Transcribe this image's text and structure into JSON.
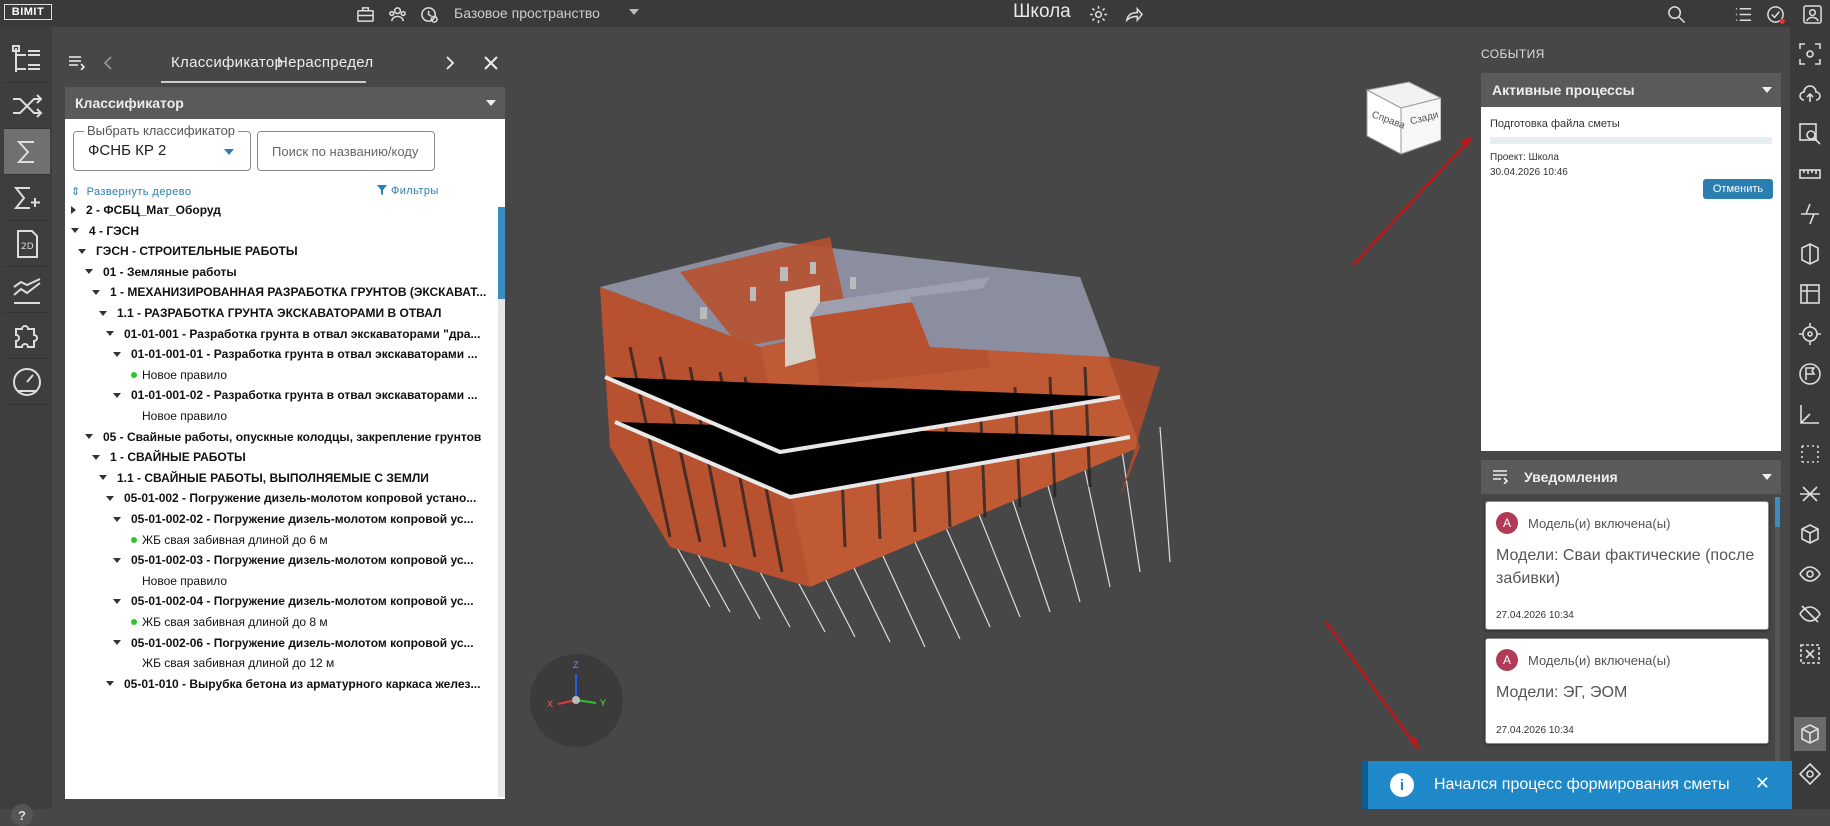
{
  "app": {
    "logo": "BIMIT",
    "space": "Базовое пространство",
    "project_title": "Школа"
  },
  "panel": {
    "tabs": [
      "Классификатор",
      "Нераспредел"
    ],
    "section_title": "Классификатор",
    "classifier_label": "Выбрать классификатор",
    "classifier_value": "ФСНБ КР 2",
    "search_placeholder": "Поиск по названию/коду",
    "expand_label": "Развернуть дерево",
    "filters_label": "Фильтры"
  },
  "tree": [
    {
      "label": "2 - ФСБЦ_Мат_Оборуд",
      "level": 0,
      "state": "collapsed"
    },
    {
      "label": "4 - ГЭСН",
      "level": 0,
      "state": "expanded"
    },
    {
      "label": "ГЭСН - СТРОИТЕЛЬНЫЕ РАБОТЫ",
      "level": 1,
      "state": "expanded"
    },
    {
      "label": "01 - Земляные работы",
      "level": 2,
      "state": "expanded"
    },
    {
      "label": "1 - МЕХАНИЗИРОВАННАЯ РАЗРАБОТКА ГРУНТОВ (ЭКСКАВАТ...",
      "level": 3,
      "state": "expanded"
    },
    {
      "label": "1.1 - РАЗРАБОТКА ГРУНТА ЭКСКАВАТОРАМИ В ОТВАЛ",
      "level": 4,
      "state": "expanded"
    },
    {
      "label": "01-01-001 - Разработка грунта в отвал экскаваторами \"дра...",
      "level": 5,
      "state": "expanded"
    },
    {
      "label": "01-01-001-01 - Разработка грунта в отвал экскаваторами ...",
      "level": 6,
      "state": "expanded"
    },
    {
      "label": "Новое правило",
      "level": 7,
      "state": "leaf",
      "dot": true
    },
    {
      "label": "01-01-001-02 - Разработка грунта в отвал экскаваторами ...",
      "level": 6,
      "state": "expanded"
    },
    {
      "label": "Новое правило",
      "level": 7,
      "state": "leaf",
      "dot": false
    },
    {
      "label": "05 - Свайные работы, опускные колодцы, закрепление грунтов",
      "level": 2,
      "state": "expanded"
    },
    {
      "label": "1 - СВАЙНЫЕ РАБОТЫ",
      "level": 3,
      "state": "expanded"
    },
    {
      "label": "1.1 - СВАЙНЫЕ РАБОТЫ, ВЫПОЛНЯЕМЫЕ С ЗЕМЛИ",
      "level": 4,
      "state": "expanded"
    },
    {
      "label": "05-01-002 - Погружение дизель-молотом копровой устано...",
      "level": 5,
      "state": "expanded"
    },
    {
      "label": "05-01-002-02 - Погружение дизель-молотом копровой ус...",
      "level": 6,
      "state": "expanded"
    },
    {
      "label": "ЖБ свая забивная длиной до 6 м",
      "level": 7,
      "state": "leaf",
      "dot": true
    },
    {
      "label": "05-01-002-03 - Погружение дизель-молотом копровой ус...",
      "level": 6,
      "state": "expanded"
    },
    {
      "label": "Новое правило",
      "level": 7,
      "state": "leaf",
      "dot": false
    },
    {
      "label": "05-01-002-04 - Погружение дизель-молотом копровой ус...",
      "level": 6,
      "state": "expanded"
    },
    {
      "label": "ЖБ свая забивная длиной до 8 м",
      "level": 7,
      "state": "leaf",
      "dot": true
    },
    {
      "label": "05-01-002-06 - Погружение дизель-молотом копровой ус...",
      "level": 6,
      "state": "expanded"
    },
    {
      "label": "ЖБ свая забивная длиной до 12 м",
      "level": 7,
      "state": "leaf",
      "dot": false
    },
    {
      "label": "05-01-010 - Вырубка бетона из арматурного каркаса желез...",
      "level": 5,
      "state": "expanded"
    }
  ],
  "viewcube": {
    "left": "Справа",
    "right": "Сзади"
  },
  "axes": {
    "z": "Z",
    "y": "Y",
    "x": "X"
  },
  "events": {
    "title": "СОБЫТИЯ",
    "active_title": "Активные процессы",
    "process": {
      "name": "Подготовка файла сметы",
      "progress": 0,
      "project": "Проект: Школа",
      "date": "30.04.2026 10:46",
      "cancel": "Отменить"
    }
  },
  "notifications": {
    "title": "Уведомления",
    "items": [
      {
        "avatar": "А",
        "header": "Модель(и) включена(ы)",
        "body": "Модели: Сваи фактические (после забивки)",
        "date": "27.04.2026 10:34"
      },
      {
        "avatar": "А",
        "header": "Модель(и) включена(ы)",
        "body": "Модели: ЭГ, ЭОМ",
        "date": "27.04.2026 10:34"
      }
    ]
  },
  "toast": {
    "message": "Начался процесс формирования сметы",
    "icon": "info-icon"
  },
  "colors": {
    "accent": "#2a7fb0",
    "toast": "#1e88c8",
    "brick": "#b7512f",
    "avatar": "#b13a57",
    "status_dot": "#2ec42e"
  }
}
